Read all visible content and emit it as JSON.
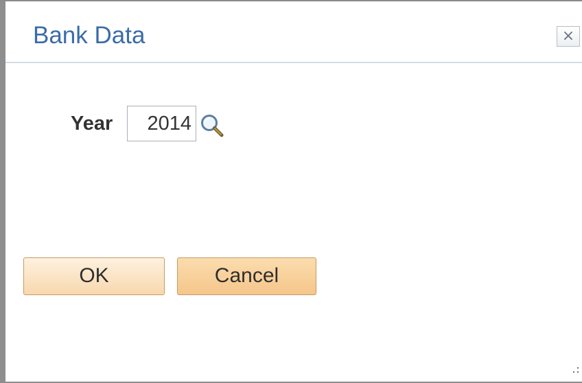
{
  "dialog": {
    "title": "Bank Data",
    "close_icon": "close-icon",
    "close_glyph": "×"
  },
  "form": {
    "year_label": "Year",
    "year_value": "2014",
    "lookup_icon": "search-icon"
  },
  "buttons": {
    "ok_label": "OK",
    "cancel_label": "Cancel"
  },
  "colors": {
    "title": "#3b6ca8",
    "button_ok": "#f8d8ae",
    "button_cancel": "#f5c68a",
    "button_border": "#c69a63"
  }
}
